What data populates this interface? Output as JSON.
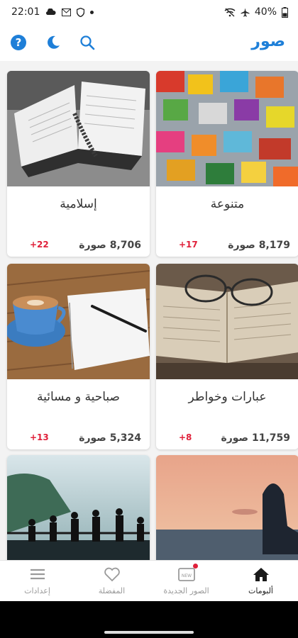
{
  "status": {
    "time": "22:01",
    "battery": "40%"
  },
  "app": {
    "title": "صور"
  },
  "colors": {
    "accent": "#1e7fd8",
    "badge": "#e0203a"
  },
  "categories": [
    {
      "name": "متنوعة",
      "count": "8,179 صورة",
      "new": "+17"
    },
    {
      "name": "إسلامية",
      "count": "8,706 صورة",
      "new": "+22"
    },
    {
      "name": "عبارات وخواطر",
      "count": "11,759 صورة",
      "new": "+8"
    },
    {
      "name": "صباحية و مسائية",
      "count": "5,324 صورة",
      "new": "+13"
    },
    {
      "name": "",
      "count": "",
      "new": ""
    },
    {
      "name": "",
      "count": "",
      "new": ""
    }
  ],
  "nav": {
    "albums": "ألبومات",
    "new_images": "الصور الجديدة",
    "new_badge": "NEW",
    "favorites": "المفضلة",
    "settings": "إعدادات"
  }
}
